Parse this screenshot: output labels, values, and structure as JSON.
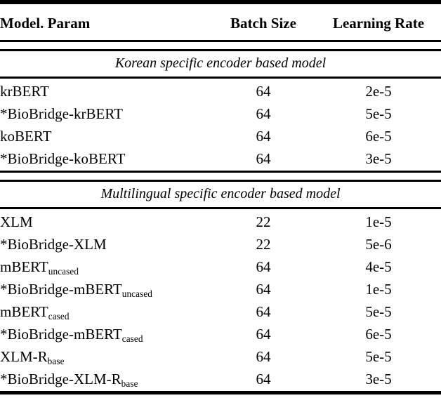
{
  "table": {
    "columns": [
      {
        "key": "model",
        "label": "Model. Param",
        "align": "left",
        "bold": true
      },
      {
        "key": "batch",
        "label": "Batch Size",
        "align": "center",
        "bold": false
      },
      {
        "key": "lr",
        "label": "Learning Rate",
        "align": "center",
        "bold": false
      }
    ],
    "sections": [
      {
        "title": "Korean specific encoder based model",
        "rows": [
          {
            "model": "krBERT",
            "model_sub": "",
            "batch": "64",
            "lr": "2e-5"
          },
          {
            "model": "*BioBridge-krBERT",
            "model_sub": "",
            "batch": "64",
            "lr": "5e-5"
          },
          {
            "model": "koBERT",
            "model_sub": "",
            "batch": "64",
            "lr": "6e-5"
          },
          {
            "model": "*BioBridge-koBERT",
            "model_sub": "",
            "batch": "64",
            "lr": "3e-5"
          }
        ]
      },
      {
        "title": "Multilingual specific encoder based model",
        "rows": [
          {
            "model": "XLM",
            "model_sub": "",
            "batch": "22",
            "lr": "1e-5"
          },
          {
            "model": "*BioBridge-XLM",
            "model_sub": "",
            "batch": "22",
            "lr": "5e-6"
          },
          {
            "model": "mBERT",
            "model_sub": "uncased",
            "batch": "64",
            "lr": "4e-5"
          },
          {
            "model": "*BioBridge-mBERT",
            "model_sub": "uncased",
            "batch": "64",
            "lr": "1e-5"
          },
          {
            "model": "mBERT",
            "model_sub": "cased",
            "batch": "64",
            "lr": "5e-5"
          },
          {
            "model": "*BioBridge-mBERT",
            "model_sub": "cased",
            "batch": "64",
            "lr": "6e-5"
          },
          {
            "model": "XLM-R",
            "model_sub": "base",
            "batch": "64",
            "lr": "5e-5"
          },
          {
            "model": "*BioBridge-XLM-R",
            "model_sub": "base",
            "batch": "64",
            "lr": "3e-5"
          }
        ]
      }
    ]
  }
}
